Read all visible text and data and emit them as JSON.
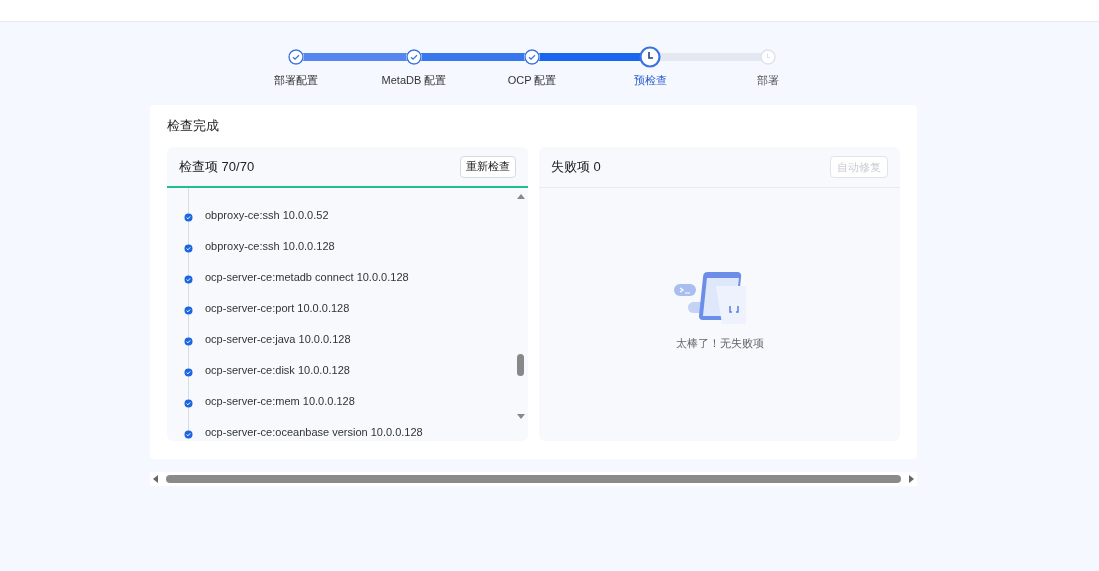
{
  "steps": [
    {
      "label": "部署配置",
      "done": true,
      "selected": false
    },
    {
      "label": "MetaDB 配置",
      "done": true,
      "selected": false
    },
    {
      "label": "OCP 配置",
      "done": true,
      "selected": false
    },
    {
      "label": "预检查",
      "done": false,
      "selected": true
    },
    {
      "label": "部署",
      "done": false,
      "selected": false
    }
  ],
  "card": {
    "title": "检查完成",
    "checks": {
      "title": "检查项 70/70",
      "button": "重新检查",
      "items": [
        {
          "text": "obproxy-ce:ssh 10.0.0.52",
          "passed": true
        },
        {
          "text": "obproxy-ce:ssh 10.0.0.128",
          "passed": true
        },
        {
          "text": "ocp-server-ce:metadb connect 10.0.0.128",
          "passed": true
        },
        {
          "text": "ocp-server-ce:port 10.0.0.128",
          "passed": true
        },
        {
          "text": "ocp-server-ce:java 10.0.0.128",
          "passed": true
        },
        {
          "text": "ocp-server-ce:disk 10.0.0.128",
          "passed": true
        },
        {
          "text": "ocp-server-ce:mem 10.0.0.128",
          "passed": true
        },
        {
          "text": "ocp-server-ce:oceanbase version 10.0.0.128",
          "passed": true
        }
      ]
    },
    "failures": {
      "title": "失败项 0",
      "button": "自动修复",
      "button_disabled": true,
      "empty_text": "太棒了！无失败项"
    }
  }
}
